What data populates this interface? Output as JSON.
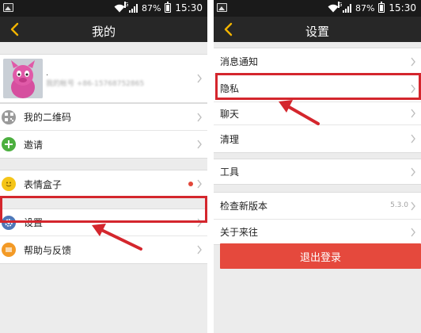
{
  "status_bar": {
    "battery": "87%",
    "time": "15:30"
  },
  "left_screen": {
    "title": "我的",
    "profile": {
      "account_text": "我的帐号 +86-15768752865",
      "dot_text": "."
    },
    "group1": [
      {
        "label": "我的二维码",
        "icon": "qr-code-icon"
      },
      {
        "label": "邀请",
        "icon": "plus-icon"
      }
    ],
    "group2": [
      {
        "label": "表情盒子",
        "icon": "smiley-icon"
      }
    ],
    "group3": [
      {
        "label": "设置",
        "icon": "gear-icon"
      },
      {
        "label": "帮助与反馈",
        "icon": "help-icon"
      }
    ]
  },
  "right_screen": {
    "title": "设置",
    "group1": [
      {
        "label": "消息通知"
      },
      {
        "label": "隐私"
      },
      {
        "label": "聊天"
      },
      {
        "label": "清理"
      }
    ],
    "group2": [
      {
        "label": "工具"
      }
    ],
    "group3": [
      {
        "label": "检查新版本",
        "value": "5.3.0"
      },
      {
        "label": "关于来往"
      }
    ],
    "logout_label": "退出登录"
  },
  "colors": {
    "accent": "#d4262d",
    "logout": "#e5493d",
    "navbar": "#272727",
    "statusbar": "#1a1a1a"
  }
}
